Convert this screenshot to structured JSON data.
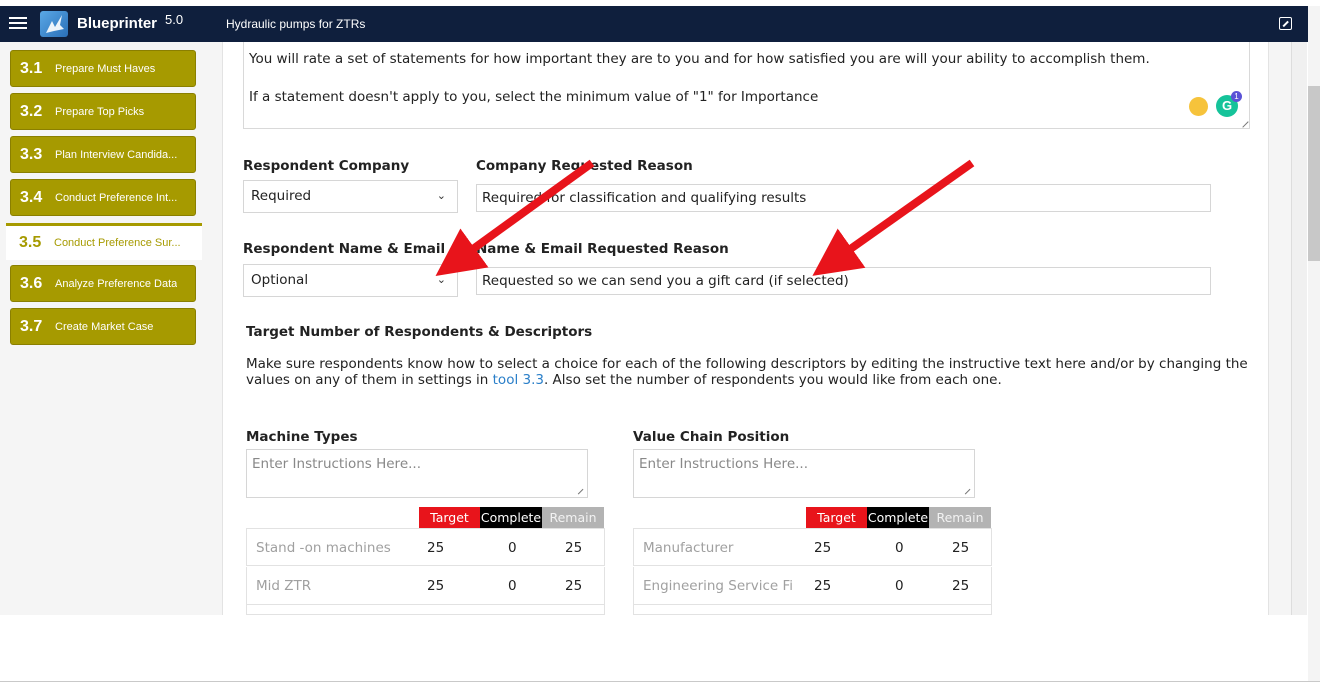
{
  "app": {
    "brand": "Blueprinter",
    "version": "5.0",
    "project": "Hydraulic pumps for ZTRs"
  },
  "sidebar": {
    "items": [
      {
        "num": "3.1",
        "label": "Prepare Must Haves"
      },
      {
        "num": "3.2",
        "label": "Prepare Top Picks"
      },
      {
        "num": "3.3",
        "label": "Plan Interview Candida..."
      },
      {
        "num": "3.4",
        "label": "Conduct Preference Int..."
      },
      {
        "num": "3.5",
        "label": "Conduct Preference Sur..."
      },
      {
        "num": "3.6",
        "label": "Analyze Preference Data"
      },
      {
        "num": "3.7",
        "label": "Create Market Case"
      }
    ],
    "active_index": 4,
    "accent_color": "#a69a00"
  },
  "intro": {
    "line1": "You will rate a set of statements for how important they are to you and for how satisfied you are will your ability to accomplish them.",
    "line2": "If a statement doesn't apply to you, select the minimum value of \"1\" for Importance",
    "grammarly_count": "1"
  },
  "form": {
    "company_label": "Respondent Company",
    "company_value": "Required",
    "company_reason_label": "Company Requested Reason",
    "company_reason_value": "Required for classification and qualifying results",
    "name_label": "Respondent Name & Email",
    "name_value": "Optional",
    "name_reason_label": "Name & Email Requested Reason",
    "name_reason_value": "Requested so we can send you a gift card (if selected)"
  },
  "targets": {
    "heading": "Target Number of Respondents & Descriptors",
    "desc_before": "Make sure respondents know how to select a choice for each of the following descriptors by editing the instructive text here and/or by changing the values on any of them in settings in ",
    "desc_link": "tool 3.3",
    "desc_after": ". Also set the number of respondents you would like from each one.",
    "columns": {
      "target": "Target",
      "complete": "Complete",
      "remain": "Remain"
    },
    "descriptors": [
      {
        "title": "Machine Types",
        "placeholder": "Enter Instructions Here...",
        "rows": [
          {
            "name": "Stand -on machines",
            "target": "25",
            "complete": "0",
            "remain": "25"
          },
          {
            "name": "Mid ZTR",
            "target": "25",
            "complete": "0",
            "remain": "25"
          }
        ]
      },
      {
        "title": "Value Chain Position",
        "placeholder": "Enter Instructions Here...",
        "rows": [
          {
            "name": "Manufacturer",
            "target": "25",
            "complete": "0",
            "remain": "25"
          },
          {
            "name": "Engineering Service Fi...",
            "target": "25",
            "complete": "0",
            "remain": "25"
          }
        ]
      }
    ]
  },
  "colors": {
    "topbar": "#0f1f3d",
    "target_header": "#e8141b",
    "complete_header": "#000000",
    "remain_header": "#b3b3b3",
    "annotation_arrow": "#e8141b",
    "link": "#2a7fc9"
  }
}
